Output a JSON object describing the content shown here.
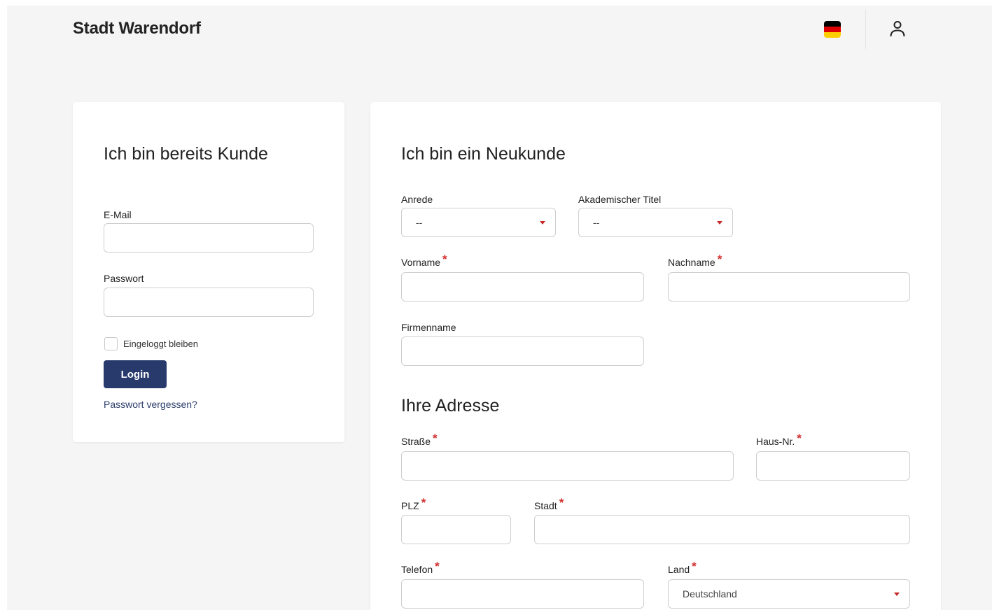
{
  "header": {
    "brand": "Stadt Warendorf",
    "language_flag": "flag-de-icon",
    "user_icon": "user-icon"
  },
  "colors": {
    "page_bg": "#f5f5f5",
    "card_bg": "#ffffff",
    "primary_button": "#283a6b",
    "required_mark": "#d32f2f",
    "flag_black": "#000000",
    "flag_red": "#dd0000",
    "flag_gold": "#ffce00"
  },
  "login": {
    "title": "Ich bin bereits Kunde",
    "email_label": "E-Mail",
    "email_value": "",
    "password_label": "Passwort",
    "password_value": "",
    "remember_label": "Eingeloggt bleiben",
    "remember_checked": false,
    "login_button": "Login",
    "forgot_link": "Passwort vergessen?"
  },
  "register": {
    "title": "Ich bin ein Neukunde",
    "required_mark": "*",
    "salutation_label": "Anrede",
    "salutation_value": "--",
    "academic_title_label": "Akademischer Titel",
    "academic_title_value": "--",
    "firstname_label": "Vorname",
    "lastname_label": "Nachname",
    "company_label": "Firmenname",
    "address_title": "Ihre Adresse",
    "street_label": "Straße",
    "house_number_label": "Haus-Nr.",
    "zip_label": "PLZ",
    "city_label": "Stadt",
    "phone_label": "Telefon",
    "country_label": "Land",
    "country_value": "Deutschland"
  }
}
